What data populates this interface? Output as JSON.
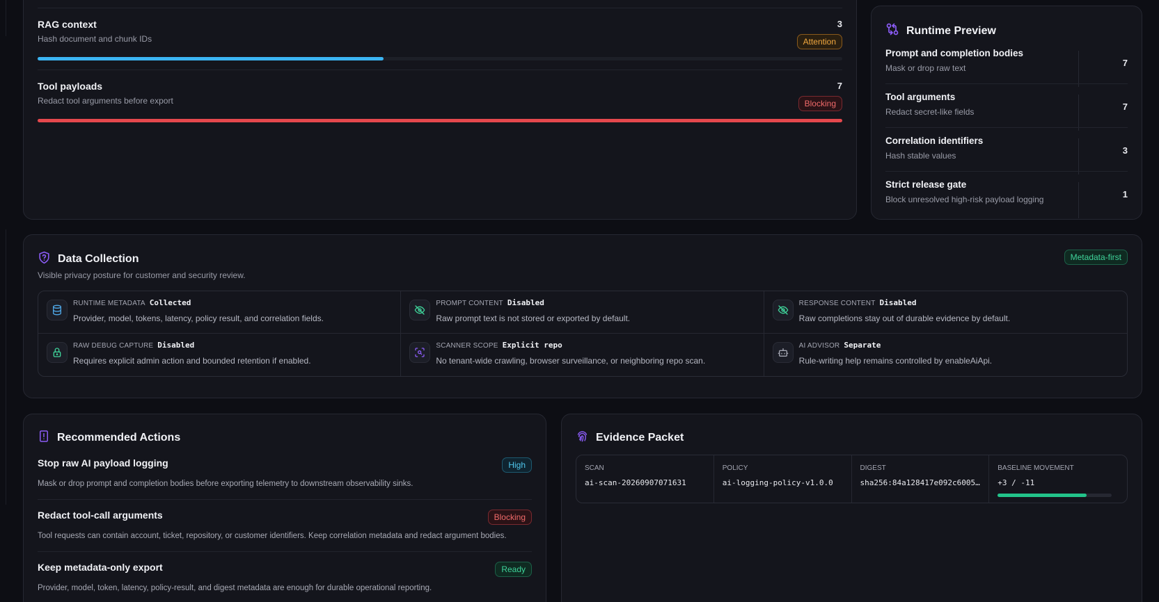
{
  "colors": {
    "accent": "#8b5cf6",
    "blue": "#3bb4f2",
    "red": "#e5484d",
    "amber": "#f3a940",
    "green": "#22c38a"
  },
  "payload_rows": [
    {
      "title": "RAG context",
      "subtitle": "Hash document and chunk IDs",
      "count": "3",
      "badge": "Attention",
      "badge_type": "attention",
      "progress": 0.43,
      "bar_color": "#3bb4f2"
    },
    {
      "title": "Tool payloads",
      "subtitle": "Redact tool arguments before export",
      "count": "7",
      "badge": "Blocking",
      "badge_type": "blocking",
      "progress": 1.0,
      "bar_color": "#e5484d"
    }
  ],
  "runtime_preview": {
    "title": "Runtime Preview",
    "icon": "git-compare-icon",
    "items": [
      {
        "title": "Prompt and completion bodies",
        "subtitle": "Mask or drop raw text",
        "count": "7"
      },
      {
        "title": "Tool arguments",
        "subtitle": "Redact secret-like fields",
        "count": "7"
      },
      {
        "title": "Correlation identifiers",
        "subtitle": "Hash stable values",
        "count": "3"
      },
      {
        "title": "Strict release gate",
        "subtitle": "Block unresolved high-risk payload logging",
        "count": "1"
      }
    ]
  },
  "data_collection": {
    "title": "Data Collection",
    "subtitle": "Visible privacy posture for customer and security review.",
    "badge": "Metadata-first",
    "icon": "shield-question-icon",
    "cells": [
      {
        "label": "Runtime metadata",
        "value": "Collected",
        "desc": "Provider, model, tokens, latency, policy result, and correlation fields.",
        "icon": "database-icon",
        "icon_color": "#4fa8e8"
      },
      {
        "label": "Prompt content",
        "value": "Disabled",
        "desc": "Raw prompt text is not stored or exported by default.",
        "icon": "eye-off-icon",
        "icon_color": "#3fd39a"
      },
      {
        "label": "Response content",
        "value": "Disabled",
        "desc": "Raw completions stay out of durable evidence by default.",
        "icon": "eye-off-icon",
        "icon_color": "#3fd39a"
      },
      {
        "label": "Raw debug capture",
        "value": "Disabled",
        "desc": "Requires explicit admin action and bounded retention if enabled.",
        "icon": "lock-icon",
        "icon_color": "#3fd39a"
      },
      {
        "label": "Scanner scope",
        "value": "Explicit repo",
        "desc": "No tenant-wide crawling, browser surveillance, or neighboring repo scan.",
        "icon": "scan-search-icon",
        "icon_color": "#8b5cf6"
      },
      {
        "label": "AI advisor",
        "value": "Separate",
        "desc": "Rule-writing help remains controlled by enableAiApi.",
        "icon": "bot-icon",
        "icon_color": "#a4a6b2"
      }
    ]
  },
  "recommended_actions": {
    "title": "Recommended Actions",
    "icon": "file-alert-icon",
    "items": [
      {
        "title": "Stop raw AI payload logging",
        "desc": "Mask or drop prompt and completion bodies before exporting telemetry to downstream observability sinks.",
        "badge": "High",
        "badge_type": "high"
      },
      {
        "title": "Redact tool-call arguments",
        "desc": "Tool requests can contain account, ticket, repository, or customer identifiers. Keep correlation metadata and redact argument bodies.",
        "badge": "Blocking",
        "badge_type": "blocking"
      },
      {
        "title": "Keep metadata-only export",
        "desc": "Provider, model, token, latency, policy-result, and digest metadata are enough for durable operational reporting.",
        "badge": "Ready",
        "badge_type": "ready"
      }
    ]
  },
  "evidence_packet": {
    "title": "Evidence Packet",
    "icon": "fingerprint-icon",
    "cells": [
      {
        "label": "Scan",
        "value": "ai-scan-20260907071631"
      },
      {
        "label": "Policy",
        "value": "ai-logging-policy-v1.0.0"
      },
      {
        "label": "Digest",
        "value": "sha256:84a128417e092c6005…"
      },
      {
        "label": "Baseline movement",
        "value": "+3 / -11",
        "progress": 0.78
      }
    ]
  }
}
